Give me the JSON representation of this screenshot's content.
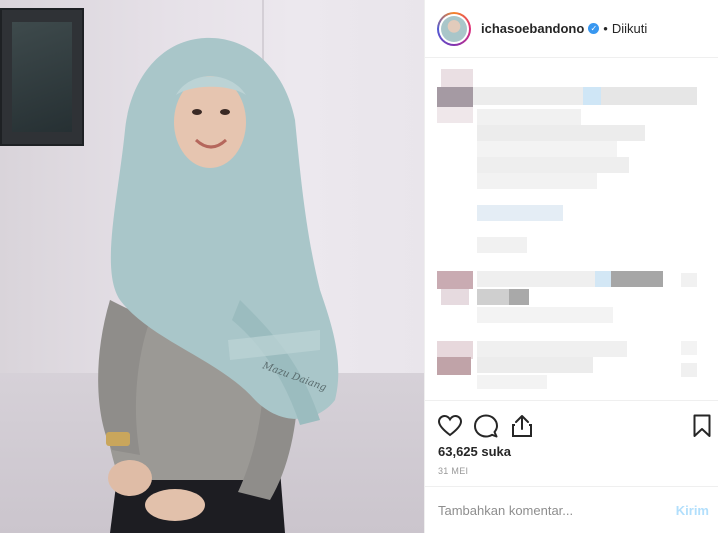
{
  "post": {
    "username": "ichasoebandono",
    "follow_status": "Diikuti",
    "separator": "•",
    "verified_mark": "✓",
    "likes_text": "63,625 suka",
    "date_text": "31 MEI"
  },
  "comment_box": {
    "placeholder": "Tambahkan komentar...",
    "post_label": "Kirim"
  },
  "photo": {
    "watermark_text": "Mazu Daiang"
  },
  "icons": {
    "like": "heart-icon",
    "comment": "comment-bubble-icon",
    "share": "share-icon",
    "save": "bookmark-icon"
  },
  "colors": {
    "link_blue": "#3897f0",
    "post_disabled": "#b2dffc",
    "hijab": "#a9c6c9",
    "dress": "#9c9a97"
  }
}
